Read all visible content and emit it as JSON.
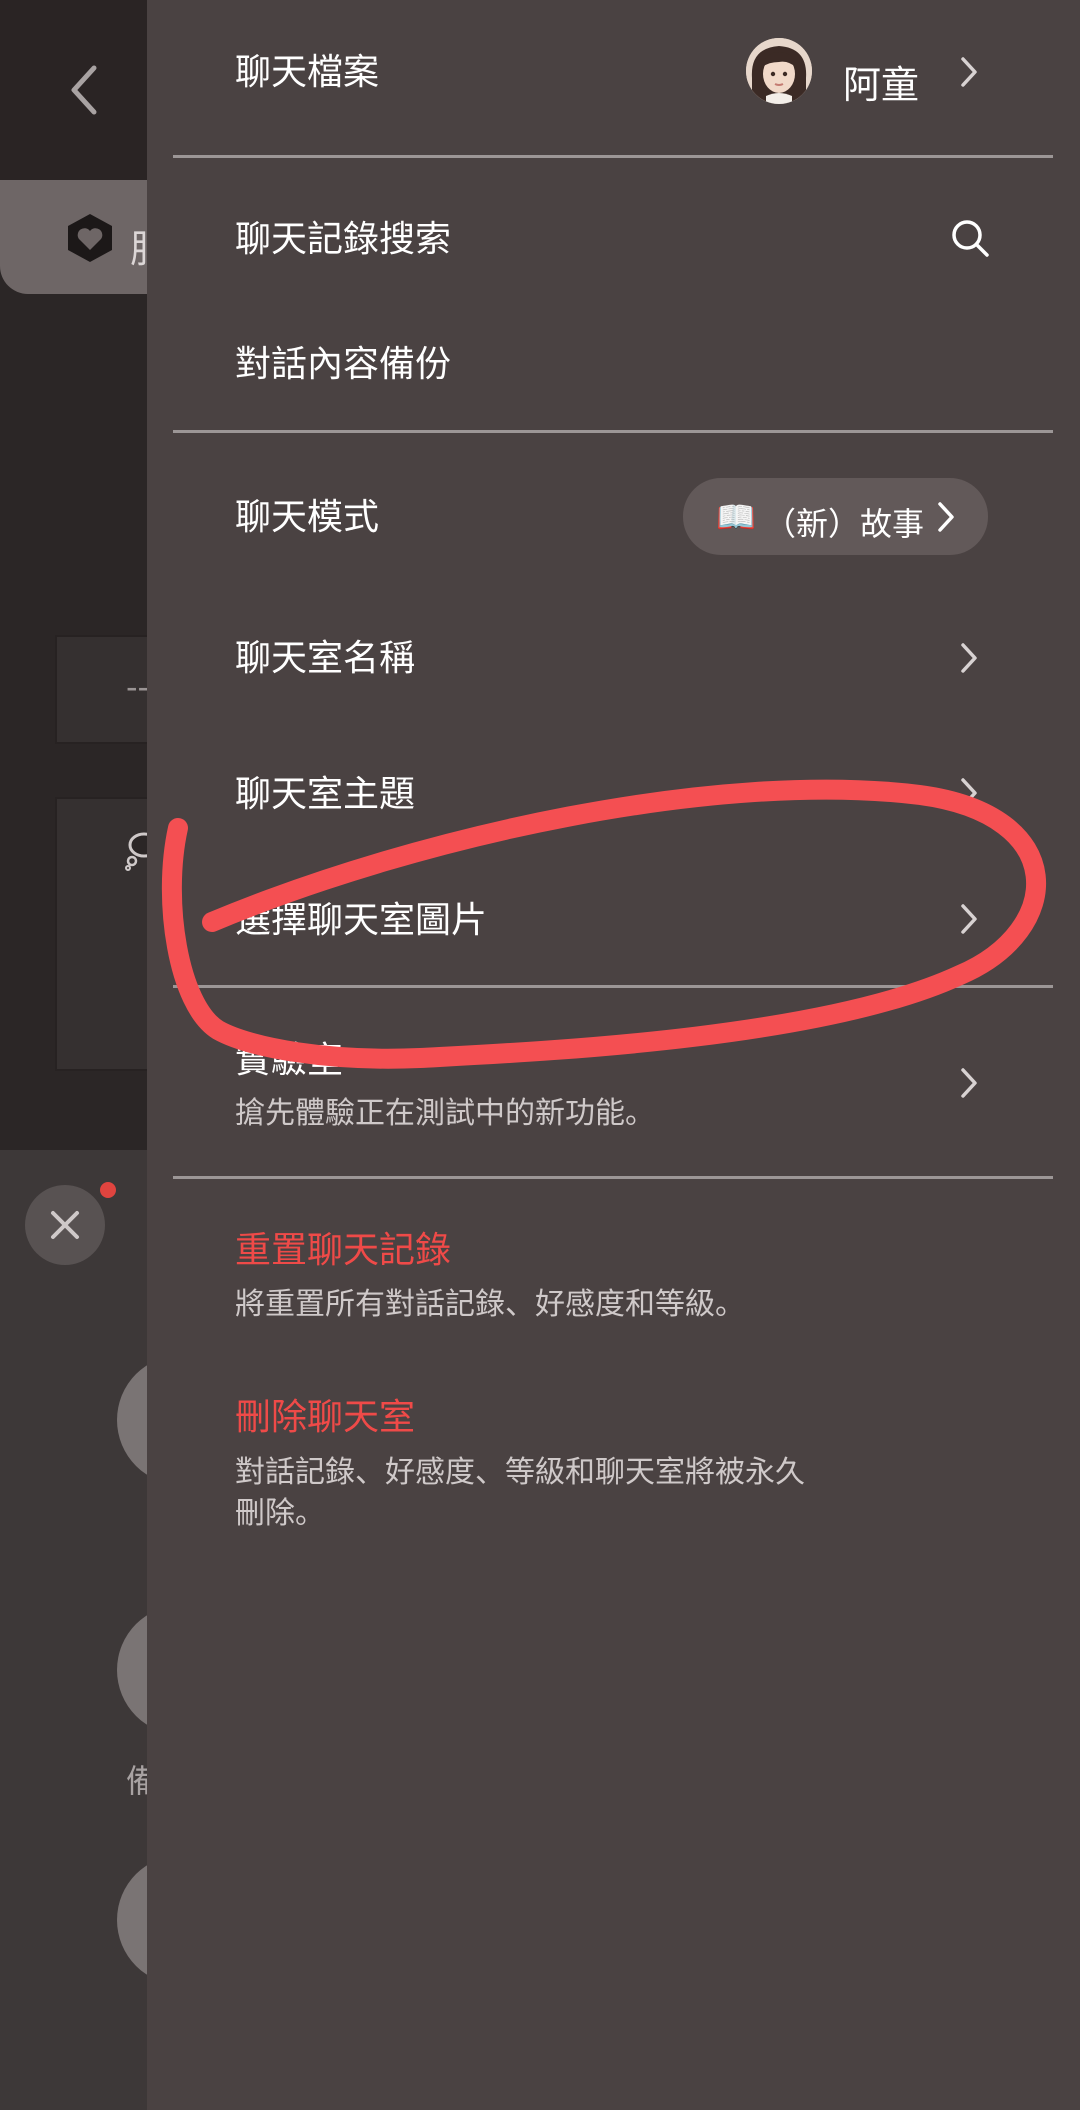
{
  "background": {
    "partial_chars": [
      "服",
      "--",
      "備"
    ]
  },
  "drawer": {
    "profile": {
      "label": "聊天檔案",
      "name": "阿童"
    },
    "search": {
      "label": "聊天記錄搜索"
    },
    "backup": {
      "label": "對話內容備份"
    },
    "mode": {
      "label": "聊天模式",
      "value": "（新）故事",
      "icon": "📖"
    },
    "room_name": {
      "label": "聊天室名稱"
    },
    "room_theme": {
      "label": "聊天室主題"
    },
    "room_image": {
      "label": "選擇聊天室圖片"
    },
    "lab": {
      "label": "實驗室",
      "desc": "搶先體驗正在測試中的新功能。"
    },
    "reset": {
      "label": "重置聊天記錄",
      "desc": "將重置所有對話記錄、好感度和等級。"
    },
    "delete": {
      "label": "刪除聊天室",
      "desc_line1": "對話記錄、好感度、等級和聊天室將被永久",
      "desc_line2": "刪除。"
    }
  },
  "colors": {
    "drawer_bg": "#4a4242",
    "danger": "#ef4a48",
    "annotation": "#f44f52",
    "divider": "#9c9696"
  }
}
